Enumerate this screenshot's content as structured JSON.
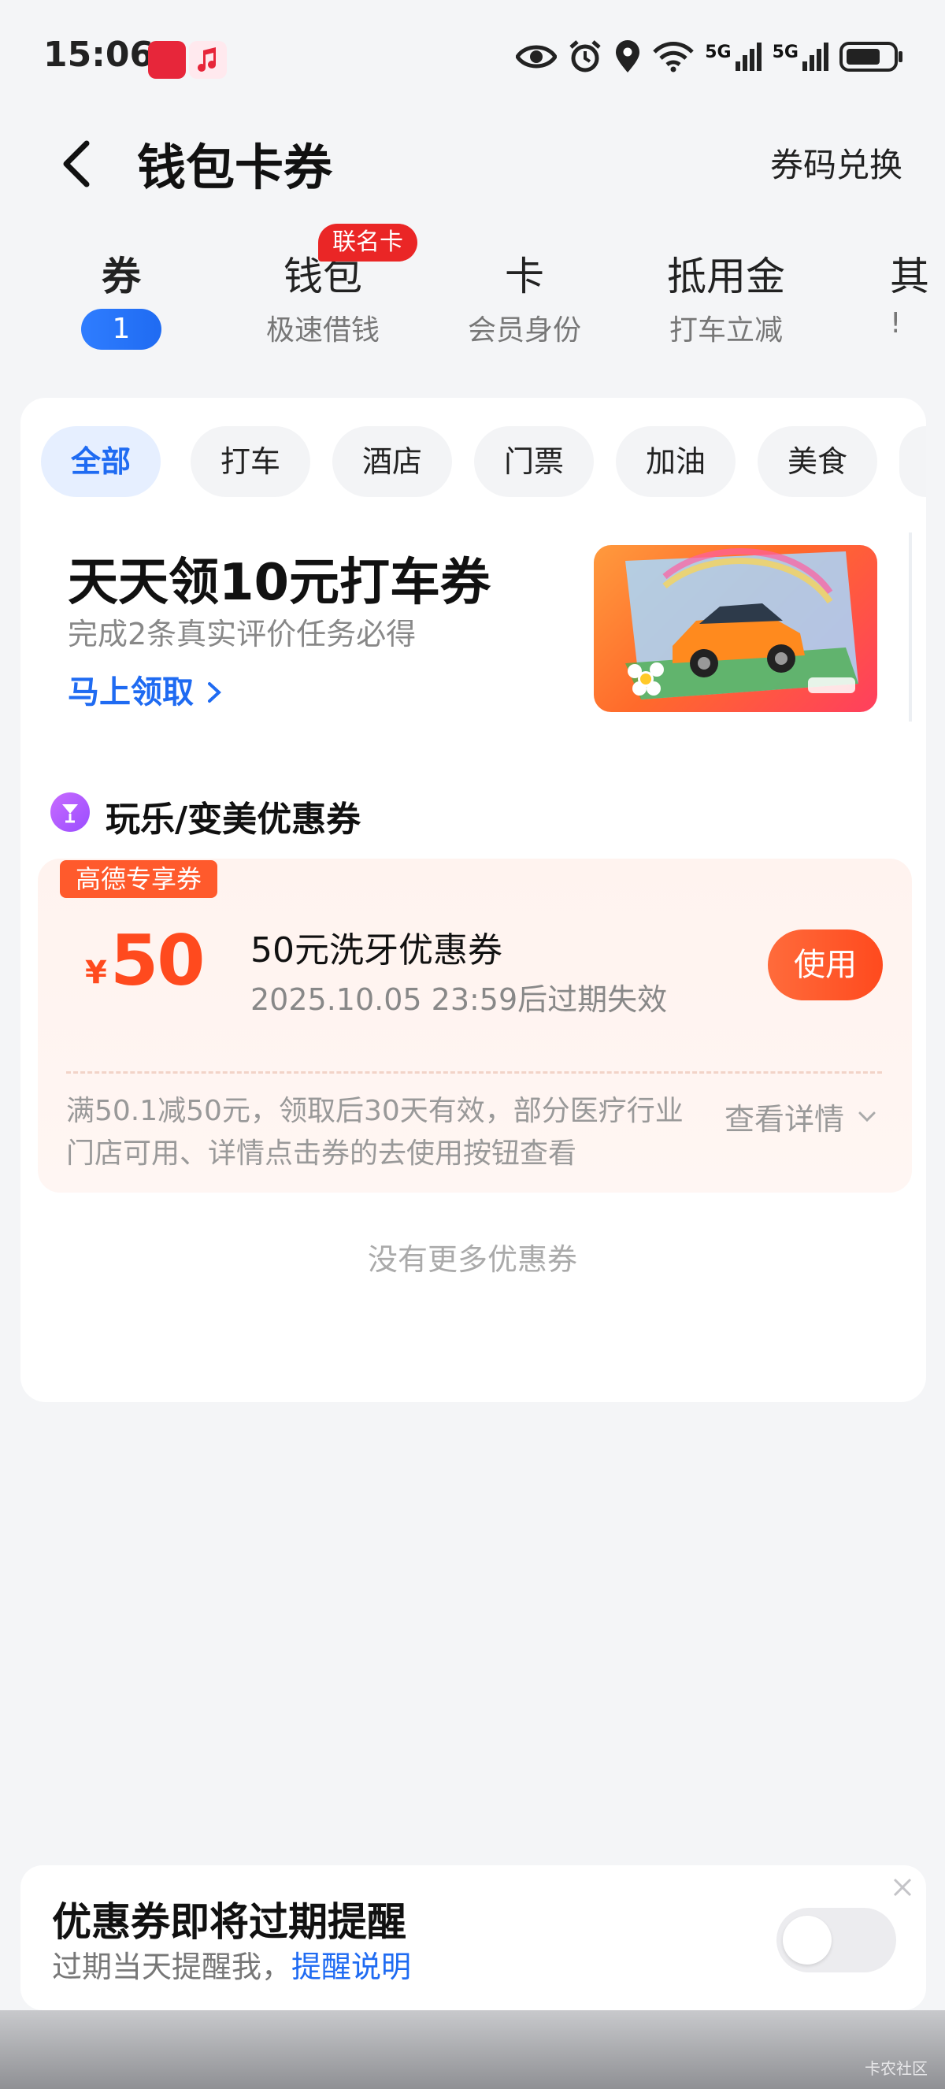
{
  "status_bar": {
    "time": "15:06",
    "network_1": "5G",
    "network_2": "5G"
  },
  "header": {
    "title": "钱包卡券",
    "redeem_label": "券码兑换"
  },
  "tabs": [
    {
      "label": "券",
      "count": "1"
    },
    {
      "label": "钱包",
      "sub": "极速借钱",
      "badge": "联名卡"
    },
    {
      "label": "卡",
      "sub": "会员身份"
    },
    {
      "label": "抵用金",
      "sub": "打车立减"
    },
    {
      "label": "其",
      "sub": "!"
    }
  ],
  "filters": [
    "全部",
    "打车",
    "酒店",
    "门票",
    "加油",
    "美食"
  ],
  "promo": {
    "title": "天天领10元打车券",
    "subtitle": "完成2条真实评价任务必得",
    "link": "马上领取"
  },
  "section": {
    "title": "玩乐/变美优惠券"
  },
  "coupon": {
    "tag": "高德专享券",
    "currency": "¥",
    "amount": "50",
    "name": "50元洗牙优惠券",
    "expiry": "2025.10.05 23:59后过期失效",
    "use_label": "使用",
    "terms": "满50.1减50元，领取后30天有效，部分医疗行业门店可用、详情点击券的去使用按钮查看",
    "details_label": "查看详情"
  },
  "no_more_text": "没有更多优惠券",
  "reminder": {
    "title": "优惠券即将过期提醒",
    "desc": "过期当天提醒我，",
    "link": "提醒说明",
    "enabled": false
  },
  "watermark": "卡农社区",
  "colors": {
    "accent_blue": "#1f6bf2",
    "accent_orange": "#ff4a1e",
    "badge_red": "#ea2626"
  }
}
